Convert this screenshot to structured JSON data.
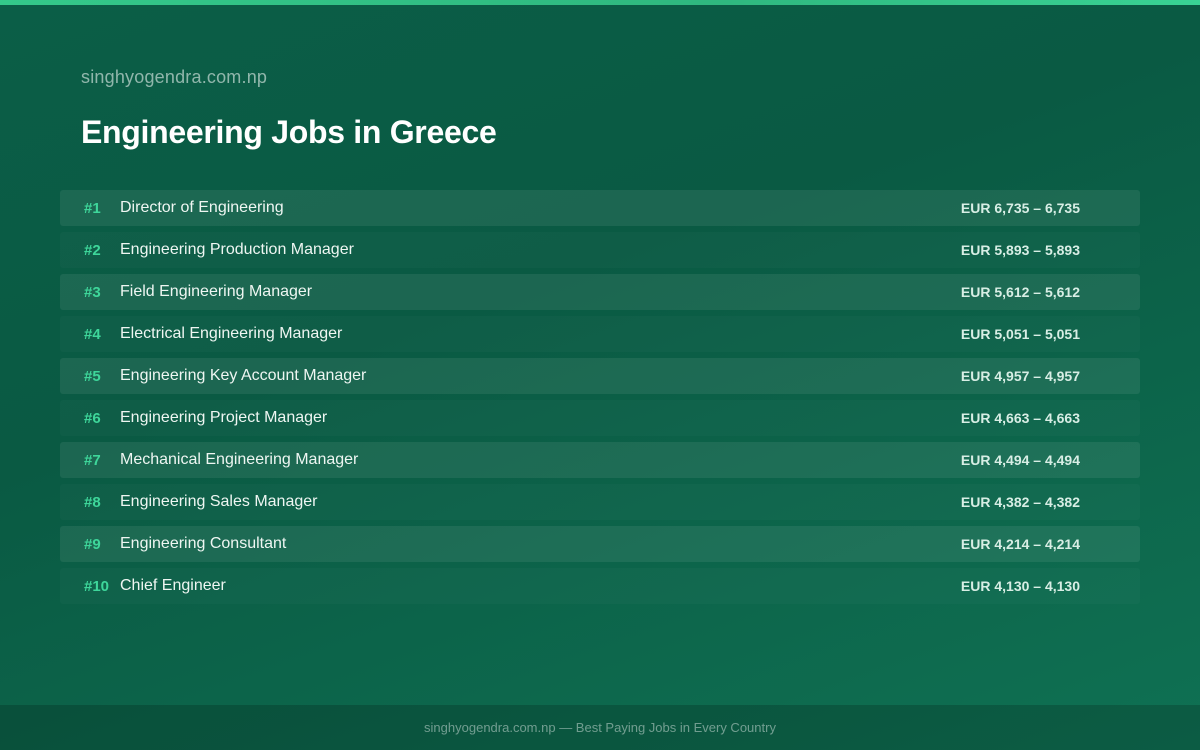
{
  "header": {
    "site_name": "singhyogendra.com.np",
    "title": "Engineering Jobs in Greece"
  },
  "jobs": [
    {
      "rank": "#1",
      "title": "Director of Engineering",
      "salary": "EUR 6,735 – 6,735"
    },
    {
      "rank": "#2",
      "title": "Engineering Production Manager",
      "salary": "EUR 5,893 – 5,893"
    },
    {
      "rank": "#3",
      "title": "Field Engineering Manager",
      "salary": "EUR 5,612 – 5,612"
    },
    {
      "rank": "#4",
      "title": "Electrical Engineering Manager",
      "salary": "EUR 5,051 – 5,051"
    },
    {
      "rank": "#5",
      "title": "Engineering Key Account Manager",
      "salary": "EUR 4,957 – 4,957"
    },
    {
      "rank": "#6",
      "title": "Engineering Project Manager",
      "salary": "EUR 4,663 – 4,663"
    },
    {
      "rank": "#7",
      "title": "Mechanical Engineering Manager",
      "salary": "EUR 4,494 – 4,494"
    },
    {
      "rank": "#8",
      "title": "Engineering Sales Manager",
      "salary": "EUR 4,382 – 4,382"
    },
    {
      "rank": "#9",
      "title": "Engineering Consultant",
      "salary": "EUR 4,214 – 4,214"
    },
    {
      "rank": "#10",
      "title": "Chief Engineer",
      "salary": "EUR 4,130 – 4,130"
    }
  ],
  "footer": {
    "text": "singhyogendra.com.np — Best Paying Jobs in Every Country"
  },
  "colors": {
    "background": "#0b5e47",
    "accent": "#3ed69a",
    "top_bar": "#34c98a"
  }
}
